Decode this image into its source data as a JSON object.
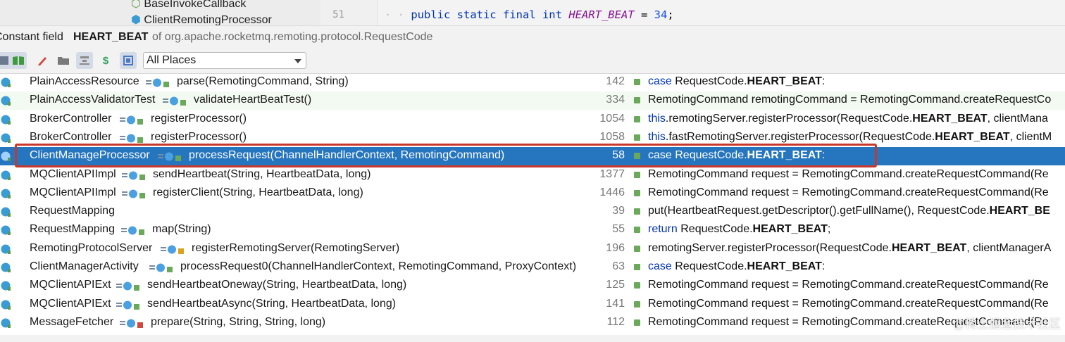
{
  "editor": {
    "tree_items": [
      "BaseInvokeCallback",
      "ClientRemotingProcessor"
    ],
    "line_number": "51",
    "code": {
      "keywords": "public static final int",
      "field": "HEART_BEAT",
      "op": "=",
      "value": "34",
      "end": ";"
    }
  },
  "header": {
    "prefix": "Constant field",
    "name": "HEART_BEAT",
    "of_text": "of org.apache.rocketmq.remoting.protocol.RequestCode"
  },
  "toolbar": {
    "buttons": [
      "group-icon",
      "book-icon",
      "pencil-icon",
      "folder-icon",
      "filter-icon",
      "dollar-icon",
      "merge-icon"
    ],
    "scope": "All Places"
  },
  "rows": [
    {
      "cls": "PlainAccessResource",
      "method": "parse(RemotingCommand, String)",
      "line": "142",
      "src_kw": "case",
      "src_pre": " RequestCode.",
      "src_bold": "HEART_BEAT",
      "src_post": ":"
    },
    {
      "cls": "PlainAccessValidatorTest",
      "method": "validateHeartBeatTest()",
      "line": "334",
      "src_kw": "",
      "src_pre": "RemotingCommand remotingCommand = RemotingCommand.createRequestCo",
      "src_bold": "",
      "src_post": ""
    },
    {
      "cls": "BrokerController",
      "method": "registerProcessor()",
      "line": "1054",
      "src_kw": "this",
      "src_pre": ".remotingServer.registerProcessor(RequestCode.",
      "src_bold": "HEART_BEAT",
      "src_post": ", clientMana"
    },
    {
      "cls": "BrokerController",
      "method": "registerProcessor()",
      "line": "1058",
      "src_kw": "this",
      "src_pre": ".fastRemotingServer.registerProcessor(RequestCode.",
      "src_bold": "HEART_BEAT",
      "src_post": ", clientM"
    },
    {
      "cls": "ClientManageProcessor",
      "method": "processRequest(ChannelHandlerContext, RemotingCommand)",
      "line": "58",
      "src_kw": "case",
      "src_pre": " RequestCode.",
      "src_bold": "HEART_BEAT",
      "src_post": ":"
    },
    {
      "cls": "MQClientAPIImpl",
      "method": "sendHeartbeat(String, HeartbeatData, long)",
      "line": "1377",
      "src_kw": "",
      "src_pre": "RemotingCommand request = RemotingCommand.createRequestCommand(Re",
      "src_bold": "",
      "src_post": ""
    },
    {
      "cls": "MQClientAPIImpl",
      "method": "registerClient(String, HeartbeatData, long)",
      "line": "1446",
      "src_kw": "",
      "src_pre": "RemotingCommand request = RemotingCommand.createRequestCommand(Re",
      "src_bold": "",
      "src_post": ""
    },
    {
      "cls": "RequestMapping",
      "method": "",
      "line": "39",
      "src_kw": "",
      "src_pre": "put(HeartbeatRequest.getDescriptor().getFullName(), RequestCode.",
      "src_bold": "HEART_BE",
      "src_post": ""
    },
    {
      "cls": "RequestMapping",
      "method": "map(String)",
      "line": "55",
      "src_kw": "return",
      "src_pre": " RequestCode.",
      "src_bold": "HEART_BEAT",
      "src_post": ";"
    },
    {
      "cls": "RemotingProtocolServer",
      "method": "registerRemotingServer(RemotingServer)",
      "line": "196",
      "src_kw": "",
      "src_pre": "remotingServer.registerProcessor(RequestCode.",
      "src_bold": "HEART_BEAT",
      "src_post": ", clientManagerA"
    },
    {
      "cls": "ClientManagerActivity",
      "method": "processRequest0(ChannelHandlerContext, RemotingCommand, ProxyContext)",
      "line": "63",
      "src_kw": "case",
      "src_pre": " RequestCode.",
      "src_bold": "HEART_BEAT",
      "src_post": ":"
    },
    {
      "cls": "MQClientAPIExt",
      "method": "sendHeartbeatOneway(String, HeartbeatData, long)",
      "line": "125",
      "src_kw": "",
      "src_pre": "RemotingCommand request = RemotingCommand.createRequestCommand(Re",
      "src_bold": "",
      "src_post": ""
    },
    {
      "cls": "MQClientAPIExt",
      "method": "sendHeartbeatAsync(String, HeartbeatData, long)",
      "line": "141",
      "src_kw": "",
      "src_pre": "RemotingCommand request = RemotingCommand.createRequestCommand(Re",
      "src_bold": "",
      "src_post": ""
    },
    {
      "cls": "MessageFetcher",
      "method": "prepare(String, String, String, long)",
      "line": "112",
      "src_kw": "",
      "src_pre": "RemotingCommand request = RemotingCommand.createRequestCommand(Re",
      "src_bold": "",
      "src_post": ""
    }
  ],
  "watermark": "@稀土掘金技术社区",
  "colors": {
    "selection": "#2675bf",
    "highlight_border": "#c8372b",
    "keyword": "#0033b3",
    "field": "#871094"
  }
}
